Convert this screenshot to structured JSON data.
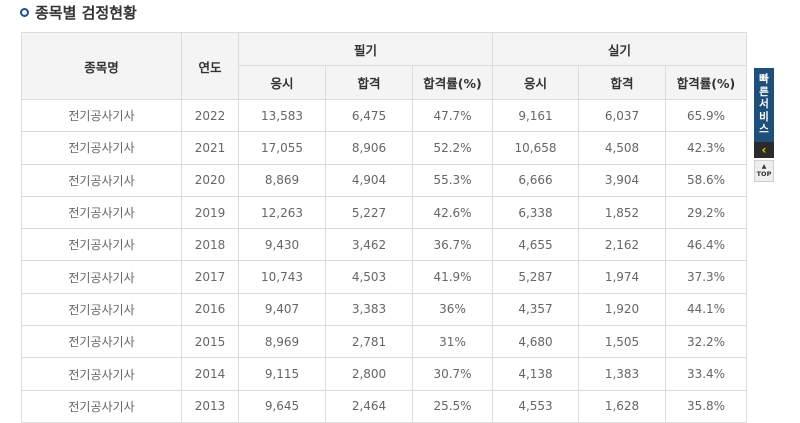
{
  "section": {
    "title": "종목별 검정현황"
  },
  "table": {
    "header": {
      "name": "종목명",
      "year": "연도",
      "written": "필기",
      "practical": "실기",
      "sub": [
        "응시",
        "합격",
        "합격률(%)",
        "응시",
        "합격",
        "합격률(%)"
      ]
    },
    "rows": [
      [
        "전기공사기사",
        "2022",
        "13,583",
        "6,475",
        "47.7%",
        "9,161",
        "6,037",
        "65.9%"
      ],
      [
        "전기공사기사",
        "2021",
        "17,055",
        "8,906",
        "52.2%",
        "10,658",
        "4,508",
        "42.3%"
      ],
      [
        "전기공사기사",
        "2020",
        "8,869",
        "4,904",
        "55.3%",
        "6,666",
        "3,904",
        "58.6%"
      ],
      [
        "전기공사기사",
        "2019",
        "12,263",
        "5,227",
        "42.6%",
        "6,338",
        "1,852",
        "29.2%"
      ],
      [
        "전기공사기사",
        "2018",
        "9,430",
        "3,462",
        "36.7%",
        "4,655",
        "2,162",
        "46.4%"
      ],
      [
        "전기공사기사",
        "2017",
        "10,743",
        "4,503",
        "41.9%",
        "5,287",
        "1,974",
        "37.3%"
      ],
      [
        "전기공사기사",
        "2016",
        "9,407",
        "3,383",
        "36%",
        "4,357",
        "1,920",
        "44.1%"
      ],
      [
        "전기공사기사",
        "2015",
        "8,969",
        "2,781",
        "31%",
        "4,680",
        "1,505",
        "32.2%"
      ],
      [
        "전기공사기사",
        "2014",
        "9,115",
        "2,800",
        "30.7%",
        "4,138",
        "1,383",
        "33.4%"
      ],
      [
        "전기공사기사",
        "2013",
        "9,645",
        "2,464",
        "25.5%",
        "4,553",
        "1,628",
        "35.8%"
      ]
    ]
  },
  "quick_service": {
    "label_chars": [
      "빠",
      "른",
      "서",
      "비",
      "스"
    ],
    "top_label": "TOP",
    "accent": "#1d4f7a"
  }
}
